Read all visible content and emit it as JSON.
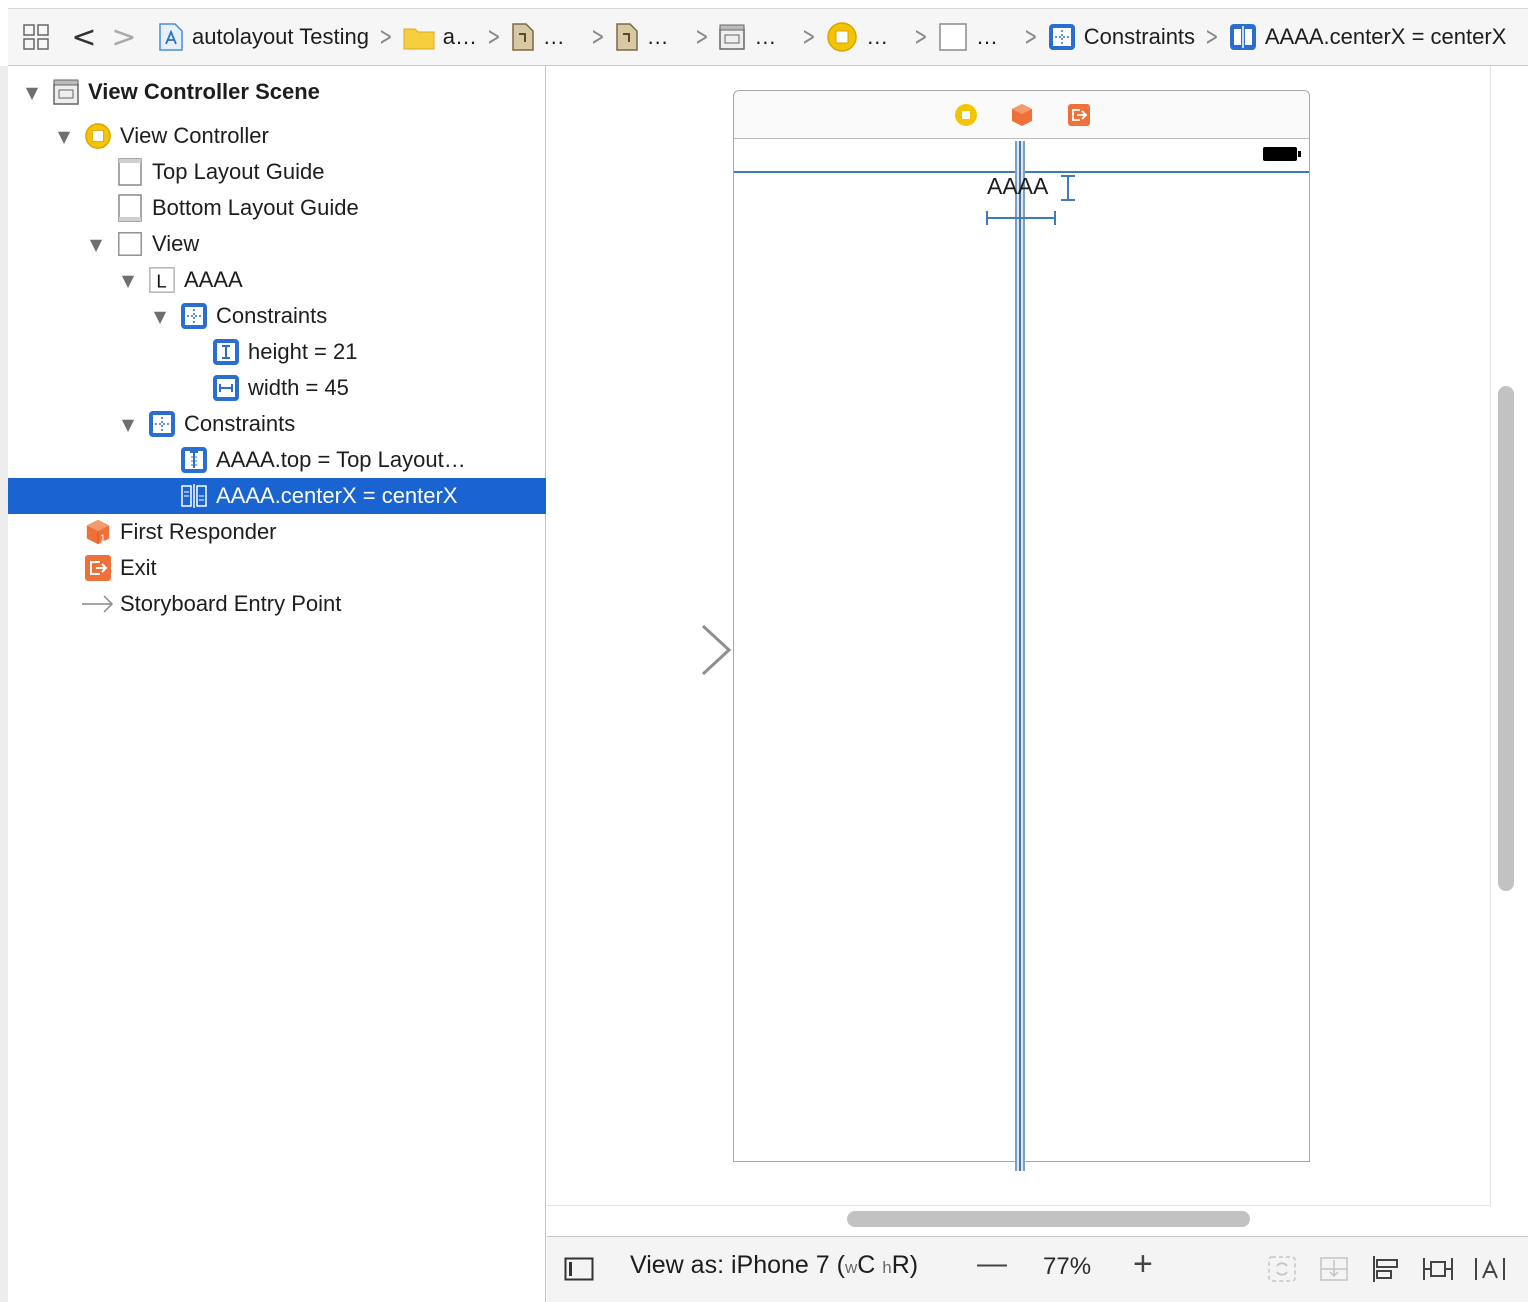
{
  "jumpbar": {
    "nav_back": "<",
    "nav_forward": ">",
    "crumbs": [
      {
        "label": "autolayout Testing",
        "icon": "project-file-icon"
      },
      {
        "label": "a…",
        "icon": "folder-icon"
      },
      {
        "label": "…",
        "icon": "storyboard-file-icon"
      },
      {
        "label": "…",
        "icon": "storyboard-base-icon"
      },
      {
        "label": "…",
        "icon": "scene-icon"
      },
      {
        "label": "…",
        "icon": "view-controller-icon"
      },
      {
        "label": "…",
        "icon": "view-icon"
      },
      {
        "label": "Constraints",
        "icon": "constraints-icon"
      },
      {
        "label": "AAAA.centerX = centerX",
        "icon": "centerx-constraint-icon"
      }
    ]
  },
  "outline": {
    "items": [
      {
        "label": "View Controller Scene",
        "icon": "scene-icon",
        "expanded": true
      },
      {
        "label": "View Controller",
        "icon": "view-controller-icon",
        "expanded": true
      },
      {
        "label": "Top Layout Guide",
        "icon": "layout-guide-icon"
      },
      {
        "label": "Bottom Layout Guide",
        "icon": "layout-guide-icon"
      },
      {
        "label": "View",
        "icon": "view-icon",
        "expanded": true
      },
      {
        "label": "AAAA",
        "icon": "label-icon",
        "expanded": true
      },
      {
        "label": "Constraints",
        "icon": "constraints-icon",
        "expanded": true
      },
      {
        "label": "height = 21",
        "icon": "height-constraint-icon"
      },
      {
        "label": "width = 45",
        "icon": "width-constraint-icon"
      },
      {
        "label": "Constraints",
        "icon": "constraints-icon",
        "expanded": true
      },
      {
        "label": "AAAA.top = Top Layout…",
        "icon": "top-constraint-icon"
      },
      {
        "label": "AAAA.centerX = centerX",
        "icon": "centerx-constraint-icon",
        "selected": true
      },
      {
        "label": "First Responder",
        "icon": "first-responder-icon"
      },
      {
        "label": "Exit",
        "icon": "exit-icon"
      },
      {
        "label": "Storyboard Entry Point",
        "icon": "entry-point-arrow-icon"
      }
    ]
  },
  "canvas": {
    "label_text": "AAAA"
  },
  "bottombar": {
    "view_as_prefix": "View as: iPhone 7 (",
    "size_class_w": "w",
    "size_class_w_value": "C",
    "size_class_h": "h",
    "size_class_h_value": "R",
    "view_as_suffix": ")",
    "zoom_minus": "—",
    "zoom": "77%",
    "zoom_plus": "+"
  },
  "colors": {
    "selection": "#1a64d2",
    "constraint_blue": "#3e7bbd",
    "vc_yellow": "#f5c400",
    "responder_orange": "#f0703a"
  }
}
